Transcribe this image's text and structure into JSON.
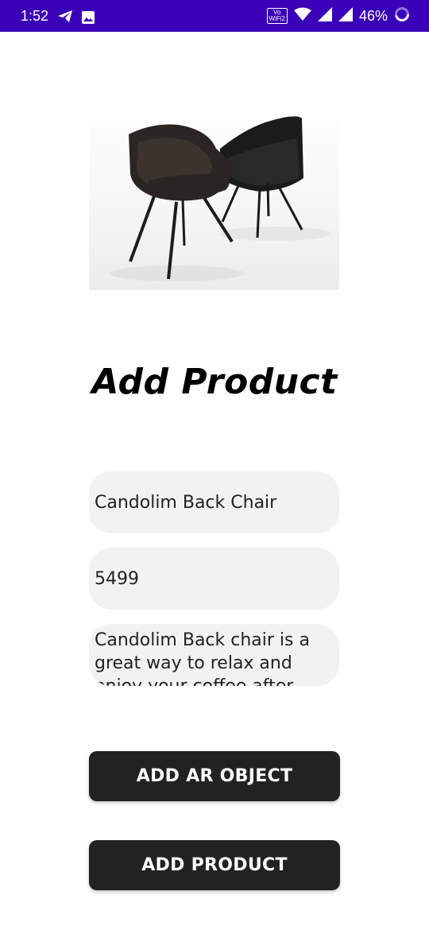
{
  "status_bar": {
    "time": "1:52",
    "volte_line1": "Vo",
    "volte_line2": "WiFi2",
    "battery": "46%",
    "icons": [
      "telegram-icon",
      "image-icon",
      "wifi-icon",
      "signal-icon",
      "battery-icon"
    ]
  },
  "page": {
    "title": "Add Product"
  },
  "product_image": {
    "alt": "two black leather chairs"
  },
  "form": {
    "name_value": "Candolim Back Chair",
    "price_value": "5499",
    "description_value": "Candolim Back chair is a great way to relax and enjoy your coffee after"
  },
  "buttons": {
    "add_ar_object": "ADD AR OBJECT",
    "add_product": "ADD PRODUCT"
  },
  "colors": {
    "status_bar": "#3a00b8",
    "button_bg": "#222222",
    "field_bg": "#f2f2f2",
    "cursor": "#2ed3c5"
  }
}
